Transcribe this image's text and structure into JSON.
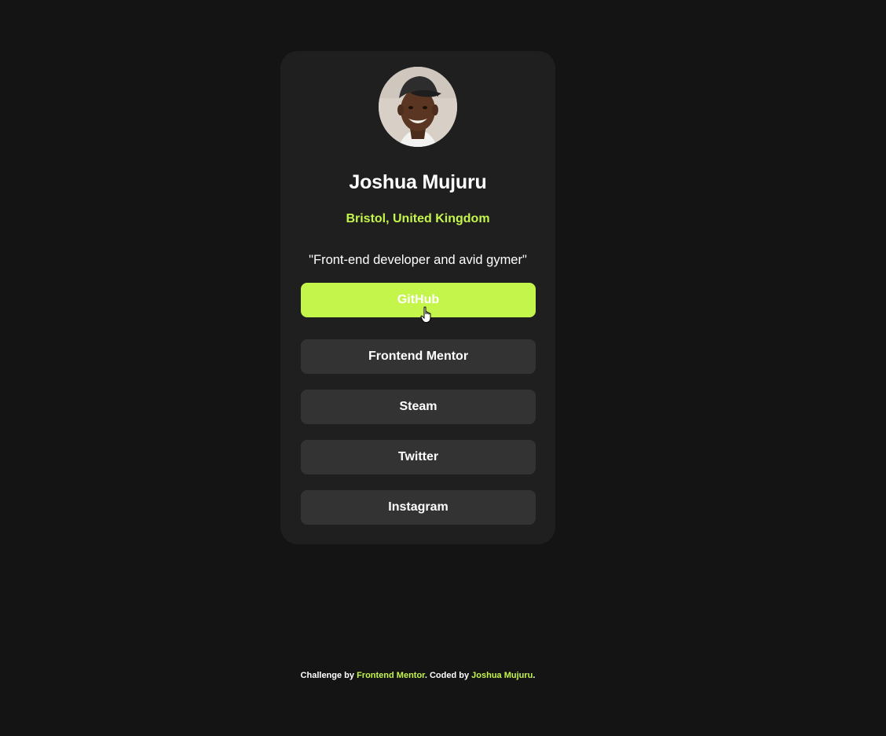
{
  "profile": {
    "name": "Joshua Mujuru",
    "location": "Bristol, United Kingdom",
    "bio": "\"Front-end developer and avid gymer\""
  },
  "links": [
    {
      "label": "GitHub",
      "active": true
    },
    {
      "label": "Frontend Mentor",
      "active": false
    },
    {
      "label": "Steam",
      "active": false
    },
    {
      "label": "Twitter",
      "active": false
    },
    {
      "label": "Instagram",
      "active": false
    }
  ],
  "footer": {
    "prefix": "Challenge by ",
    "challenge_link": "Frontend Mentor",
    "middle": ". Coded by ",
    "author_link": "Joshua Mujuru",
    "suffix": "."
  },
  "colors": {
    "page_background": "#141414",
    "card_background": "#1f1f1f",
    "button_background": "#333333",
    "accent": "#c4f54b"
  },
  "icons": {
    "cursor": "hand-pointer-icon"
  }
}
